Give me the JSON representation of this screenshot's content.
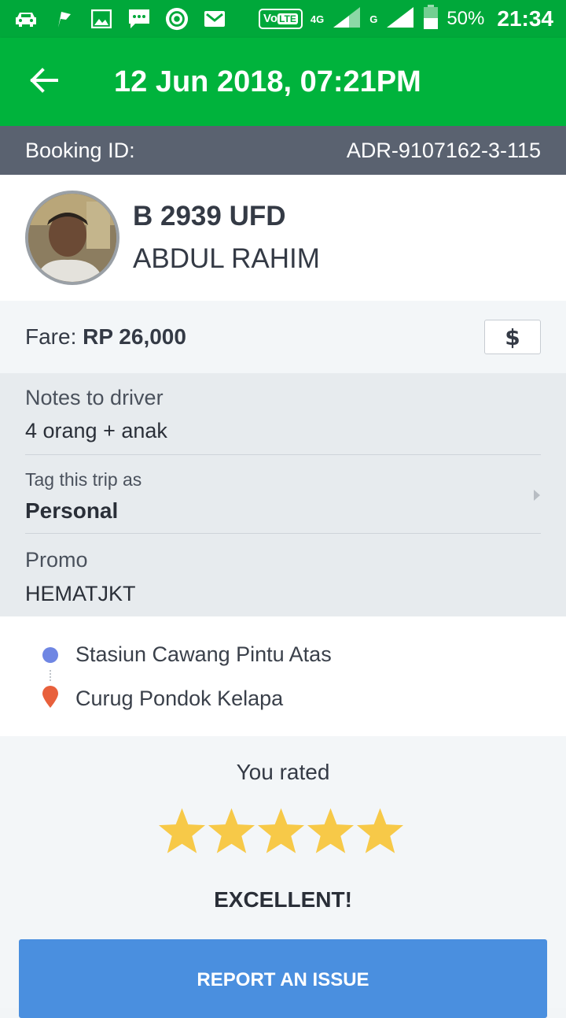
{
  "status_bar": {
    "network_badge": "VoLTE",
    "network_4g": "4G",
    "network_g": "G",
    "battery_percent": "50%",
    "time": "21:34",
    "icons": [
      "car-icon",
      "flag-icon",
      "image-icon",
      "chat-icon",
      "camera-icon",
      "mail-icon"
    ]
  },
  "header": {
    "title": "12 Jun 2018, 07:21PM",
    "back_icon": "arrow-left-icon"
  },
  "booking": {
    "label": "Booking ID:",
    "value": "ADR-9107162-3-115"
  },
  "driver": {
    "plate": "B 2939 UFD",
    "name": "ABDUL RAHIM"
  },
  "fare": {
    "label": "Fare:",
    "amount": "RP 26,000",
    "payment_icon": "dollar-icon"
  },
  "details": {
    "notes_label": "Notes to driver",
    "notes_value": "4 orang + anak",
    "tag_label": "Tag this trip as",
    "tag_value": "Personal",
    "promo_label": "Promo",
    "promo_value": "HEMATJKT"
  },
  "route": {
    "origin": "Stasiun Cawang Pintu Atas",
    "destination": "Curug Pondok Kelapa"
  },
  "rating": {
    "label": "You rated",
    "stars": 5,
    "max_stars": 5,
    "verdict": "EXCELLENT!",
    "star_color": "#f7c948"
  },
  "actions": {
    "report_label": "REPORT AN ISSUE"
  },
  "colors": {
    "brand_green": "#00b33c",
    "booking_bar": "#5a6270",
    "button_blue": "#4a8fdf",
    "origin_dot": "#6f86e3",
    "destination_pin": "#e8603c"
  }
}
